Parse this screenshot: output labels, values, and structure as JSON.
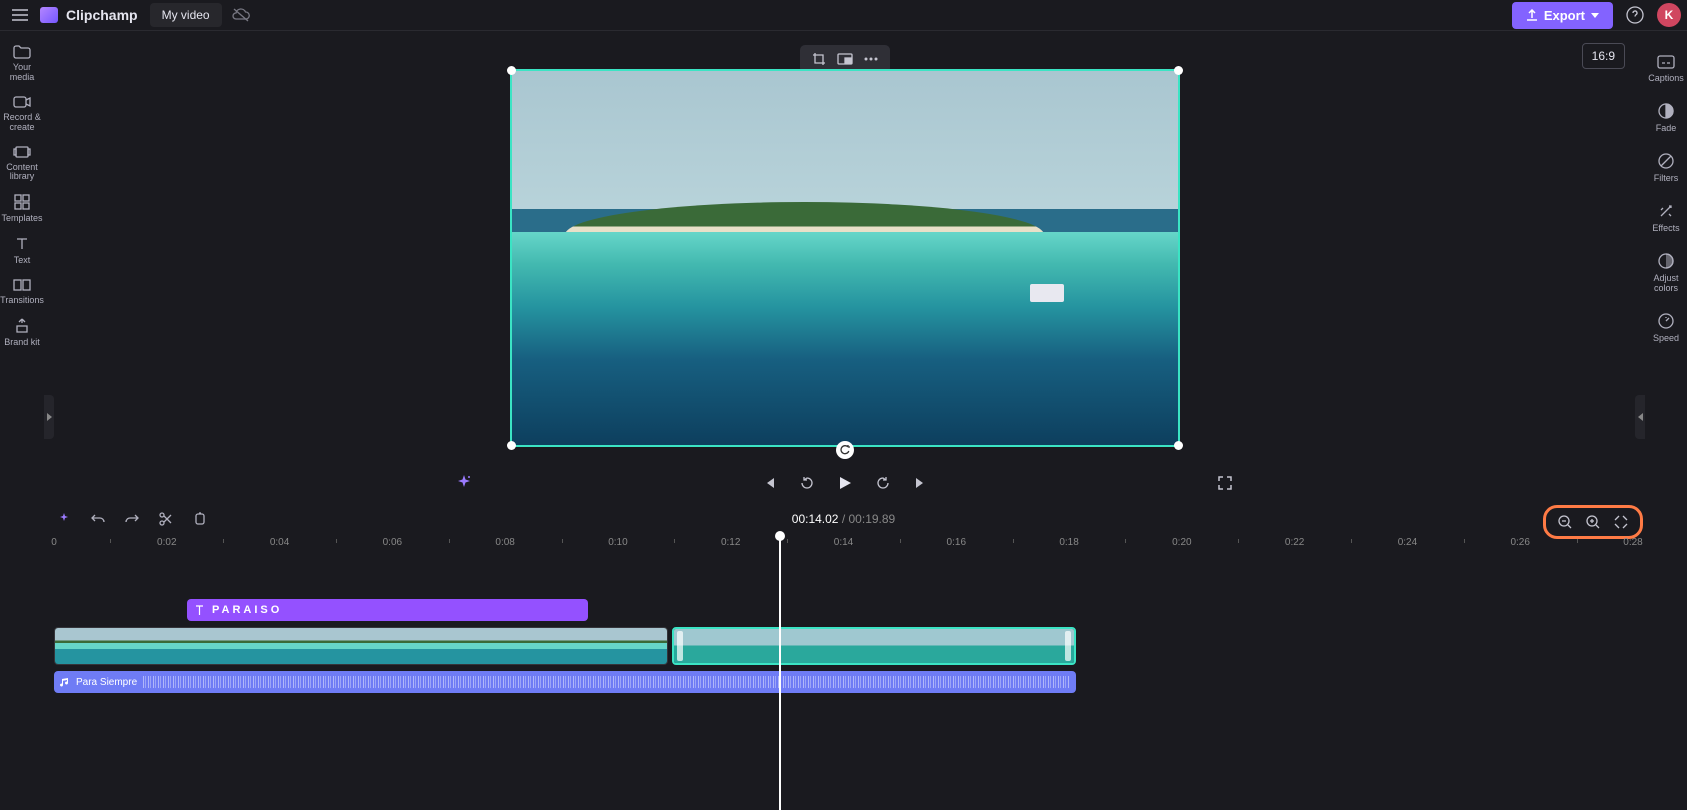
{
  "header": {
    "brand": "Clipchamp",
    "video_name": "My video",
    "export_label": "Export",
    "avatar_letter": "K"
  },
  "left_sidebar": [
    {
      "id": "your-media",
      "label": "Your media"
    },
    {
      "id": "record-create",
      "label": "Record & create"
    },
    {
      "id": "content-library",
      "label": "Content library"
    },
    {
      "id": "templates",
      "label": "Templates"
    },
    {
      "id": "text",
      "label": "Text"
    },
    {
      "id": "transitions",
      "label": "Transitions"
    },
    {
      "id": "brand-kit",
      "label": "Brand kit"
    }
  ],
  "right_sidebar": [
    {
      "id": "captions",
      "label": "Captions"
    },
    {
      "id": "fade",
      "label": "Fade"
    },
    {
      "id": "filters",
      "label": "Filters"
    },
    {
      "id": "effects",
      "label": "Effects"
    },
    {
      "id": "adjust-colors",
      "label": "Adjust colors"
    },
    {
      "id": "speed",
      "label": "Speed"
    }
  ],
  "preview": {
    "aspect": "16:9"
  },
  "playback": {
    "current": "00:14.02",
    "separator": " / ",
    "total": "00:19.89"
  },
  "ruler": [
    "0",
    "0:02",
    "0:04",
    "0:06",
    "0:08",
    "0:10",
    "0:12",
    "0:14",
    "0:16",
    "0:18",
    "0:20",
    "0:22",
    "0:24",
    "0:26",
    "0:28"
  ],
  "text_clip": {
    "label": "PARAISO"
  },
  "audio_clip": {
    "label": "Para Siempre"
  }
}
